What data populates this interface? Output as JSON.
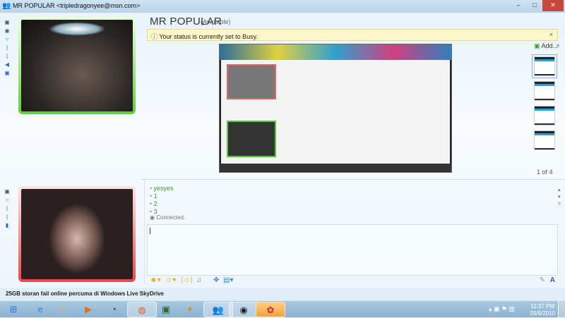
{
  "window": {
    "title": "MR POPULAR <tripledragonyee@msn.com>",
    "controls": [
      "–",
      "□",
      "✕"
    ]
  },
  "contact": {
    "name": "MR POPULAR",
    "status": "(Available)"
  },
  "notice": {
    "text": "Your status is currently set to Busy.",
    "close": "×"
  },
  "share": {
    "add_label": "Add...",
    "close": "×",
    "page": "1 of 4",
    "count": 4
  },
  "chat": {
    "messages": [
      "yesyes",
      "1",
      "2",
      "3"
    ],
    "system": "Connected."
  },
  "input": {
    "value": ""
  },
  "ad": {
    "text": "25GB storan fail online percuma di Windows Live SkyDrive"
  },
  "taskbar": {
    "time": "11:37 PM",
    "date": "29/8/2010"
  },
  "colors": {
    "contact_frame": "#5fcf3a",
    "self_frame": "#e64c4c",
    "message": "#3c9a2c"
  }
}
